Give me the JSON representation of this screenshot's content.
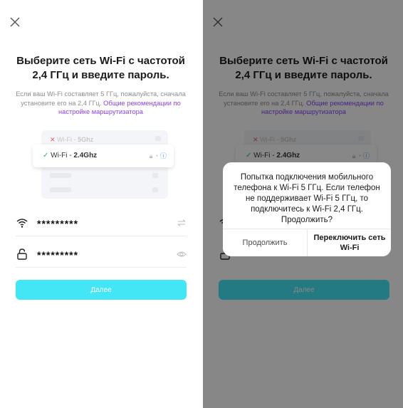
{
  "screen": {
    "title": "Выберите сеть Wi-Fi с частотой 2,4 ГГц и введите пароль.",
    "description_plain": "Если ваш Wi-Fi составляет 5 ГГц, пожалуйста, сначала установите его на 2,4 ГГц.",
    "description_link": "Общие рекомендации по настройке маршрутизатора",
    "wifi_5g_prefix": "Wi-Fi - ",
    "wifi_5g_freq": "5Ghz",
    "wifi_24_prefix": "Wi-Fi - ",
    "wifi_24_freq": "2.4Ghz",
    "ssid_value": "*********",
    "password_value": "*********",
    "next_label": "Далее"
  },
  "dialog": {
    "message": "Попытка подключения мобильного телефона к Wi-Fi 5 ГГц. Если телефон не поддерживает Wi-Fi 5 ГГц, то подключитесь к Wi-Fi 2,4 ГГц. Продолжить?",
    "continue_label": "Продолжить",
    "switch_label": "Переключить сеть Wi-Fi"
  },
  "colors": {
    "accent": "#42e6f5",
    "link": "#8a3ffc",
    "check": "#38b36a",
    "cross": "#e05c5c"
  },
  "icons": [
    "close-icon",
    "wifi-icon",
    "lock-icon",
    "swap-icon",
    "eye-icon",
    "info-icon"
  ]
}
